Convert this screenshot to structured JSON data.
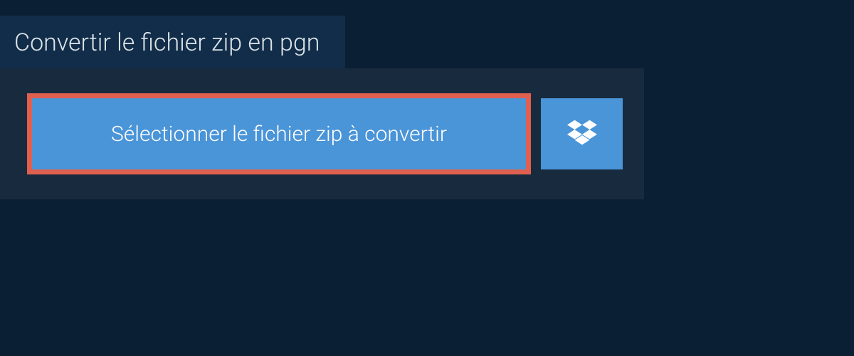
{
  "title": "Convertir le fichier zip en pgn",
  "buttons": {
    "select_file_label": "Sélectionner le fichier zip à convertir"
  },
  "colors": {
    "bg": "#0a1f33",
    "panel": "#182b3e",
    "tab": "#112d49",
    "button": "#4a94d8",
    "highlight_border": "#e0604f",
    "text_light": "#dce3e8",
    "text_white": "#ffffff"
  }
}
